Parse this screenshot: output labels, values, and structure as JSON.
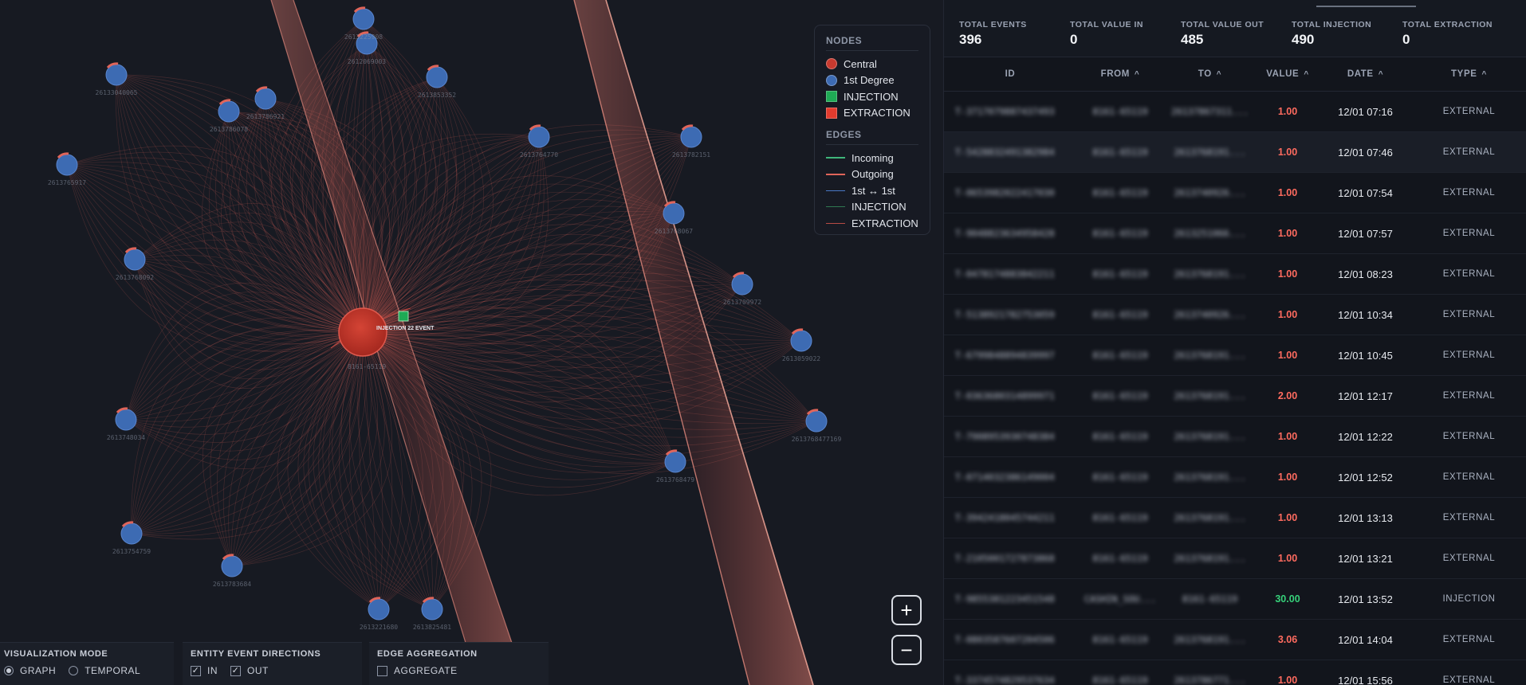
{
  "legend": {
    "nodes_title": "NODES",
    "edges_title": "EDGES",
    "nodes": [
      {
        "label": "Central",
        "color": "#c83a2f",
        "shape": "circle"
      },
      {
        "label": "1st Degree",
        "color": "#3d6bb3",
        "shape": "circle"
      },
      {
        "label": "INJECTION",
        "color": "#1faa55",
        "shape": "square"
      },
      {
        "label": "EXTRACTION",
        "color": "#e23b2e",
        "shape": "square"
      }
    ],
    "edges": [
      {
        "label": "Incoming",
        "color": "#3fb67a"
      },
      {
        "label": "Outgoing",
        "color": "#e0655a"
      },
      {
        "label": "1st ↔ 1st",
        "color": "#4a78c6"
      },
      {
        "label": "INJECTION",
        "color": "#2f7a52"
      },
      {
        "label": "EXTRACTION",
        "color": "#b84b45"
      }
    ]
  },
  "graph": {
    "central": {
      "label": "8161-65119",
      "tag": "INJECTION 22 EVENT"
    },
    "peripheral_labels": [
      "26133040065",
      "2612069003",
      "2613853352",
      "2613786921",
      "2613786078",
      "2613764770",
      "2613782151",
      "2613765917",
      "2613768067",
      "2613768092",
      "2613709972",
      "2613059022",
      "2613768477169",
      "2613768479",
      "2613748034",
      "2613754759",
      "2613783684",
      "2613221680",
      "2613825481",
      "2613225908"
    ]
  },
  "zoom": {
    "in_label": "+",
    "out_label": "−"
  },
  "controls": {
    "visualization_mode": {
      "title": "VISUALIZATION MODE",
      "options": [
        "GRAPH",
        "TEMPORAL"
      ],
      "selected": "GRAPH"
    },
    "entity_event_directions": {
      "title": "ENTITY EVENT DIRECTIONS",
      "options": [
        "IN",
        "OUT"
      ]
    },
    "edge_aggregation": {
      "title": "EDGE AGGREGATION",
      "option": "AGGREGATE"
    }
  },
  "stats": [
    {
      "label": "TOTAL EVENTS",
      "value": "396"
    },
    {
      "label": "TOTAL VALUE IN",
      "value": "0"
    },
    {
      "label": "TOTAL VALUE OUT",
      "value": "485"
    },
    {
      "label": "TOTAL INJECTION",
      "value": "490"
    },
    {
      "label": "TOTAL EXTRACTION",
      "value": "0"
    }
  ],
  "table": {
    "headers": {
      "id": "ID",
      "from": "FROM",
      "to": "TO",
      "value": "VALUE",
      "date": "DATE",
      "type": "TYPE"
    },
    "rows": [
      {
        "id": "T-3717079887437493",
        "from": "8161-65119",
        "to": "26137867311...",
        "value": "1.00",
        "date": "12/01 07:16",
        "type": "EXTERNAL",
        "kind": "out"
      },
      {
        "id": "T-5428832491382984",
        "from": "8161-65119",
        "to": "2613768191...",
        "value": "1.00",
        "date": "12/01 07:46",
        "type": "EXTERNAL",
        "kind": "out"
      },
      {
        "id": "T-0653982022417030",
        "from": "8161-65119",
        "to": "2613740926...",
        "value": "1.00",
        "date": "12/01 07:54",
        "type": "EXTERNAL",
        "kind": "out"
      },
      {
        "id": "T-9048823634958428",
        "from": "8161-65119",
        "to": "2613251066...",
        "value": "1.00",
        "date": "12/01 07:57",
        "type": "EXTERNAL",
        "kind": "out"
      },
      {
        "id": "T-0478174883842211",
        "from": "8161-65119",
        "to": "2613768191...",
        "value": "1.00",
        "date": "12/01 08:23",
        "type": "EXTERNAL",
        "kind": "out"
      },
      {
        "id": "T-5138921782753059",
        "from": "8161-65119",
        "to": "2613740926...",
        "value": "1.00",
        "date": "12/01 10:34",
        "type": "EXTERNAL",
        "kind": "out"
      },
      {
        "id": "T-6799848894839997",
        "from": "8161-65119",
        "to": "2613768191...",
        "value": "1.00",
        "date": "12/01 10:45",
        "type": "EXTERNAL",
        "kind": "out"
      },
      {
        "id": "T-0363680314899971",
        "from": "8161-65119",
        "to": "2613768191...",
        "value": "2.00",
        "date": "12/01 12:17",
        "type": "EXTERNAL",
        "kind": "out"
      },
      {
        "id": "T-7908953930748384",
        "from": "8161-65119",
        "to": "2613768191...",
        "value": "1.00",
        "date": "12/01 12:22",
        "type": "EXTERNAL",
        "kind": "out"
      },
      {
        "id": "T-0714032386149004",
        "from": "8161-65119",
        "to": "2613768191...",
        "value": "1.00",
        "date": "12/01 12:52",
        "type": "EXTERNAL",
        "kind": "out"
      },
      {
        "id": "T-3942418045744211",
        "from": "8161-65119",
        "to": "2613768191...",
        "value": "1.00",
        "date": "12/01 13:13",
        "type": "EXTERNAL",
        "kind": "out"
      },
      {
        "id": "T-2105001727873868",
        "from": "8161-65119",
        "to": "2613768191...",
        "value": "1.00",
        "date": "12/01 13:21",
        "type": "EXTERNAL",
        "kind": "out"
      },
      {
        "id": "T-9855381223451548",
        "from": "CASHIN_SOU...",
        "to": "8161-65119",
        "value": "30.00",
        "date": "12/01 13:52",
        "type": "INJECTION",
        "kind": "inj"
      },
      {
        "id": "T-0803587607204506",
        "from": "8161-65119",
        "to": "2613768191...",
        "value": "3.06",
        "date": "12/01 14:04",
        "type": "EXTERNAL",
        "kind": "out"
      },
      {
        "id": "T-3374574829537634",
        "from": "8161-65119",
        "to": "2613786771...",
        "value": "1.00",
        "date": "12/01 15:56",
        "type": "EXTERNAL",
        "kind": "out"
      }
    ]
  }
}
